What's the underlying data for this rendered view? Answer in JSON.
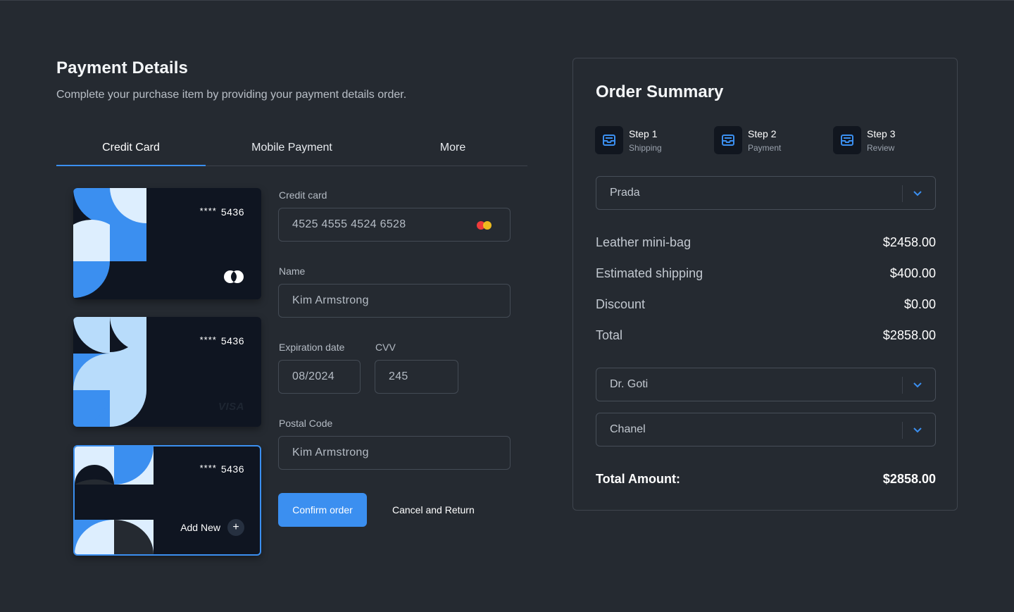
{
  "header": {
    "title": "Payment Details",
    "subtitle": "Complete your purchase item by providing your payment details order."
  },
  "tabs": [
    {
      "label": "Credit Card",
      "active": true
    },
    {
      "label": "Mobile Payment",
      "active": false
    },
    {
      "label": "More",
      "active": false
    }
  ],
  "cards": [
    {
      "stars": "****",
      "last4": "5436",
      "brand": "mastercard-icon"
    },
    {
      "stars": "****",
      "last4": "5436",
      "brand": "VISA"
    },
    {
      "stars": "****",
      "last4": "5436",
      "action": "Add New",
      "action_icon": "+"
    }
  ],
  "form": {
    "credit_card_label": "Credit card",
    "credit_card_value": "4525 4555 4524 6528",
    "name_label": "Name",
    "name_value": "Kim Armstrong",
    "expiration_label": "Expiration date",
    "expiration_value": "08/2024",
    "cvv_label": "CVV",
    "cvv_value": "245",
    "postal_label": "Postal Code",
    "postal_value": "Kim Armstrong",
    "confirm_label": "Confirm order",
    "cancel_label": "Cancel and Return"
  },
  "summary": {
    "title": "Order Summary",
    "steps": [
      {
        "title": "Step 1",
        "sub": "Shipping"
      },
      {
        "title": "Step 2",
        "sub": "Payment"
      },
      {
        "title": "Step 3",
        "sub": "Review"
      }
    ],
    "select_brand": "Prada",
    "lines": [
      {
        "label": "Leather mini-bag",
        "value": "$2458.00"
      },
      {
        "label": "Estimated shipping",
        "value": "$400.00"
      },
      {
        "label": "Discount",
        "value": "$0.00"
      },
      {
        "label": "Total",
        "value": "$2858.00"
      }
    ],
    "select_2": "Dr. Goti",
    "select_3": "Chanel",
    "total_amount_label": "Total Amount:",
    "total_amount_value": "$2858.00"
  },
  "colors": {
    "background": "#252a31",
    "accent": "#3b8ff0",
    "card": "#0f1521",
    "light_blue": "#b8dcfb"
  }
}
